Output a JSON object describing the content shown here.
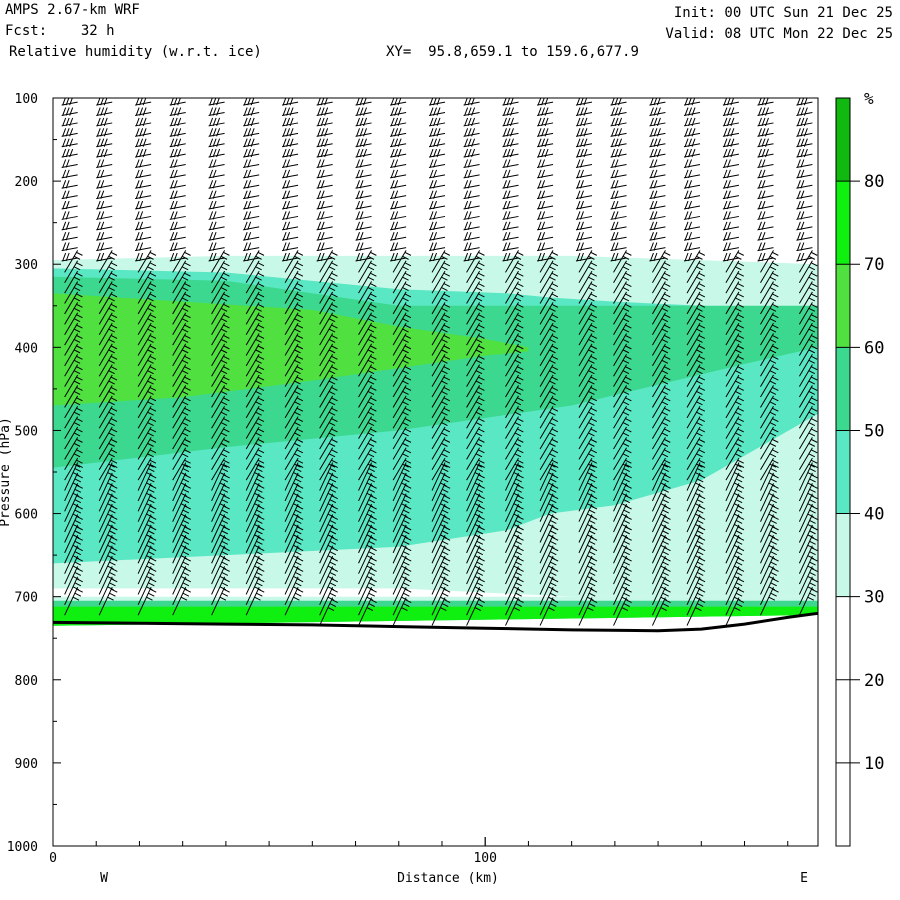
{
  "header": {
    "model": "AMPS 2.67-km WRF",
    "fcst_label": "Fcst:",
    "fcst_value": "32 h",
    "field": "Relative humidity (w.r.t. ice)",
    "xy_label": "XY=",
    "xy_value": "95.8,659.1 to 159.6,677.9",
    "init": "Init: 00 UTC Sun 21 Dec 25",
    "valid": "Valid: 08 UTC Mon 22 Dec 25"
  },
  "chart_data": {
    "type": "heatmap",
    "title": "Relative humidity (w.r.t. ice)",
    "xlabel": "Distance (km)",
    "ylabel": "Pressure (hPa)",
    "xlim": [
      0,
      177
    ],
    "ylim": [
      1000,
      100
    ],
    "x_ticks": [
      0,
      100
    ],
    "x_tick_labels": [
      "0",
      "100"
    ],
    "x_end_labels": [
      "W",
      "E"
    ],
    "y_ticks": [
      100,
      200,
      300,
      400,
      500,
      600,
      700,
      800,
      900,
      1000
    ],
    "y_tick_labels": [
      "100",
      "200",
      "300",
      "400",
      "500",
      "600",
      "700",
      "800",
      "900",
      "1000"
    ],
    "colorbar": {
      "unit": "%",
      "levels": [
        0,
        10,
        20,
        30,
        40,
        50,
        60,
        70,
        80,
        90
      ],
      "labels": [
        "10",
        "20",
        "30",
        "40",
        "50",
        "60",
        "70",
        "80"
      ],
      "label_values": [
        10,
        20,
        30,
        40,
        50,
        60,
        70,
        80
      ],
      "colors": [
        "#ffffff",
        "#ffffff",
        "#ffffff",
        "#c8f8e8",
        "#5ae8c4",
        "#3cd890",
        "#50e040",
        "#10f010",
        "#10b810"
      ]
    },
    "terrain": {
      "x": [
        0,
        20,
        40,
        60,
        80,
        100,
        120,
        140,
        150,
        160,
        170,
        177
      ],
      "pressure": [
        731,
        732,
        733,
        734,
        736,
        738,
        740,
        741,
        739,
        733,
        725,
        720
      ]
    },
    "shading": [
      {
        "level": 30,
        "x": [
          0,
          40,
          80,
          120,
          150,
          177
        ],
        "top": [
          295,
          290,
          290,
          290,
          295,
          300
        ],
        "bottom": [
          690,
          690,
          690,
          700,
          700,
          700
        ]
      },
      {
        "level": 40,
        "x": [
          0,
          40,
          80,
          105,
          115,
          130,
          150,
          177
        ],
        "top": [
          305,
          310,
          330,
          335,
          340,
          345,
          350,
          355
        ],
        "bottom": [
          660,
          650,
          640,
          620,
          600,
          590,
          560,
          480
        ]
      },
      {
        "level": 50,
        "x": [
          0,
          40,
          80,
          120,
          160,
          177
        ],
        "top": [
          315,
          320,
          350,
          350,
          350,
          350
        ],
        "bottom": [
          545,
          520,
          500,
          470,
          420,
          400
        ]
      },
      {
        "level": 60,
        "x": [
          0,
          30,
          60,
          80,
          100,
          110
        ],
        "top": [
          335,
          345,
          355,
          375,
          390,
          400
        ],
        "bottom": [
          470,
          460,
          440,
          425,
          410,
          405
        ]
      },
      {
        "level": 30,
        "x": [
          0,
          177
        ],
        "top": [
          700,
          700
        ],
        "bottom": [
          735,
          722
        ]
      },
      {
        "level": 50,
        "x": [
          0,
          177
        ],
        "top": [
          705,
          705
        ],
        "bottom": [
          735,
          722
        ]
      },
      {
        "level": 70,
        "x": [
          0,
          177
        ],
        "top": [
          712,
          712
        ],
        "bottom": [
          735,
          722
        ]
      }
    ],
    "barbs": {
      "note": "wind barb columns",
      "column_x": [
        2,
        10,
        19,
        27,
        36,
        44,
        53,
        61,
        70,
        78,
        87,
        95,
        104,
        112,
        121,
        129,
        138,
        146,
        155,
        163,
        172
      ]
    }
  }
}
